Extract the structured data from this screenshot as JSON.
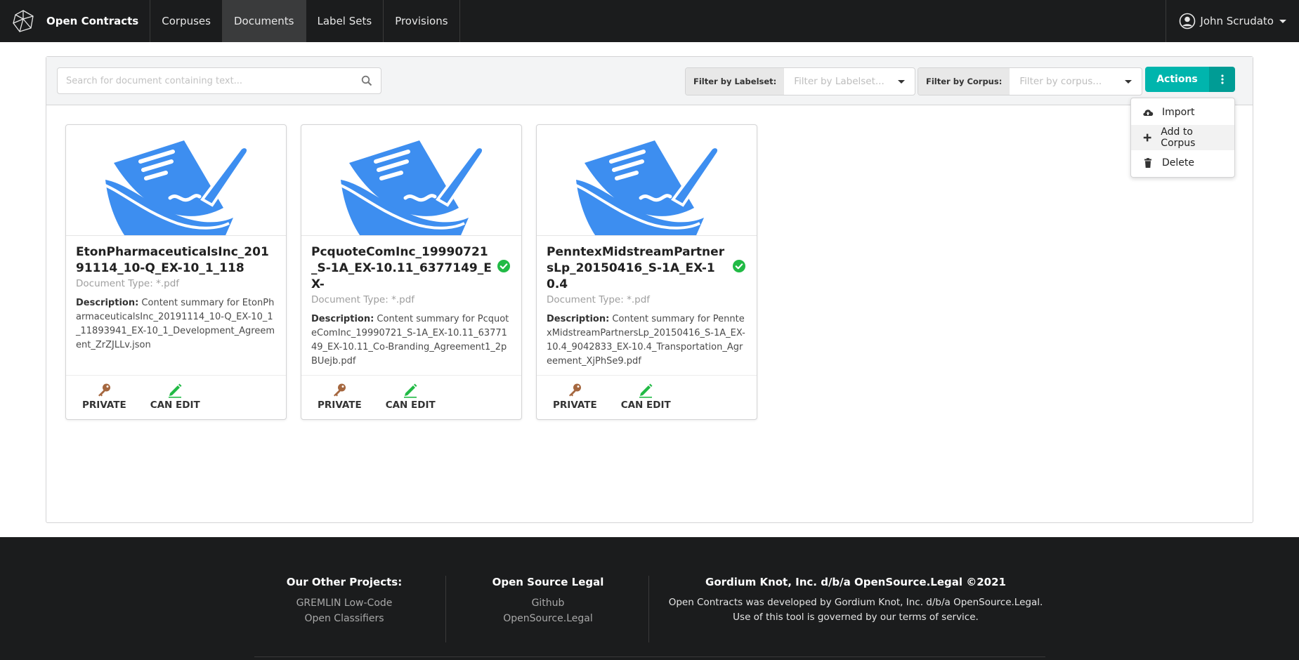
{
  "nav": {
    "brand": "Open Contracts",
    "items": [
      "Corpuses",
      "Documents",
      "Label Sets",
      "Provisions"
    ],
    "active": "Documents",
    "user": "John Scrudato"
  },
  "toolbar": {
    "search_placeholder": "Search for document containing text...",
    "labelset_label": "Filter by Labelset:",
    "labelset_placeholder": "Filter by Labelset...",
    "corpus_label": "Filter by Corpus:",
    "corpus_placeholder": "Filter by corpus...",
    "actions_label": "Actions",
    "accent_color": "#00b5ad"
  },
  "actions_menu": {
    "items": [
      {
        "label": "Import",
        "icon": "cloud-upload-icon"
      },
      {
        "label": "Add to Corpus",
        "icon": "plus-icon"
      },
      {
        "label": "Delete",
        "icon": "trash-icon"
      }
    ],
    "hovered": "Add to Corpus"
  },
  "cards": [
    {
      "title": "EtonPharmaceuticalsInc_20191114_10-Q_EX-10_1_118",
      "verified": false,
      "doc_type": "Document Type: *.pdf",
      "desc_label": "Description:",
      "description": "Content summary for EtonPharmaceuticalsInc_20191114_10-Q_EX-10_1_11893941_EX-10_1_Development_Agreement_ZrZJLLv.json",
      "perm_private": "PRIVATE",
      "perm_edit": "CAN EDIT"
    },
    {
      "title": "PcquoteComInc_19990721_S-1A_EX-10.11_6377149_EX-",
      "verified": true,
      "doc_type": "Document Type: *.pdf",
      "desc_label": "Description:",
      "description": "Content summary for PcquoteComInc_19990721_S-1A_EX-10.11_6377149_EX-10.11_Co-Branding_Agreement1_2pBUejb.pdf",
      "perm_private": "PRIVATE",
      "perm_edit": "CAN EDIT"
    },
    {
      "title": "PenntexMidstreamPartnersLp_20150416_S-1A_EX-10.4",
      "verified": true,
      "doc_type": "Document Type: *.pdf",
      "desc_label": "Description:",
      "description": "Content summary for PenntexMidstreamPartnersLp_20150416_S-1A_EX-10.4_9042833_EX-10.4_Transportation_Agreement_XjPhSe9.pdf",
      "perm_private": "PRIVATE",
      "perm_edit": "CAN EDIT"
    }
  ],
  "footer": {
    "col1_title": "Our Other Projects:",
    "col1_links": [
      "GREMLIN Low-Code",
      "Open Classifiers"
    ],
    "col2_title": "Open Source Legal",
    "col2_links": [
      "Github",
      "OpenSource.Legal"
    ],
    "col3_title": "Gordium Knot, Inc. d/b/a OpenSource.Legal ©2021",
    "col3_text": "Open Contracts was developed by Gordium Knot, Inc. d/b/a OpenSource.Legal. Use of this tool is governed by our terms of service."
  },
  "colors": {
    "doc_icon_blue": "#3d8ef0",
    "check_green": "#21ba45",
    "key_brown": "#a5673f",
    "pencil_green": "#21ba45"
  }
}
